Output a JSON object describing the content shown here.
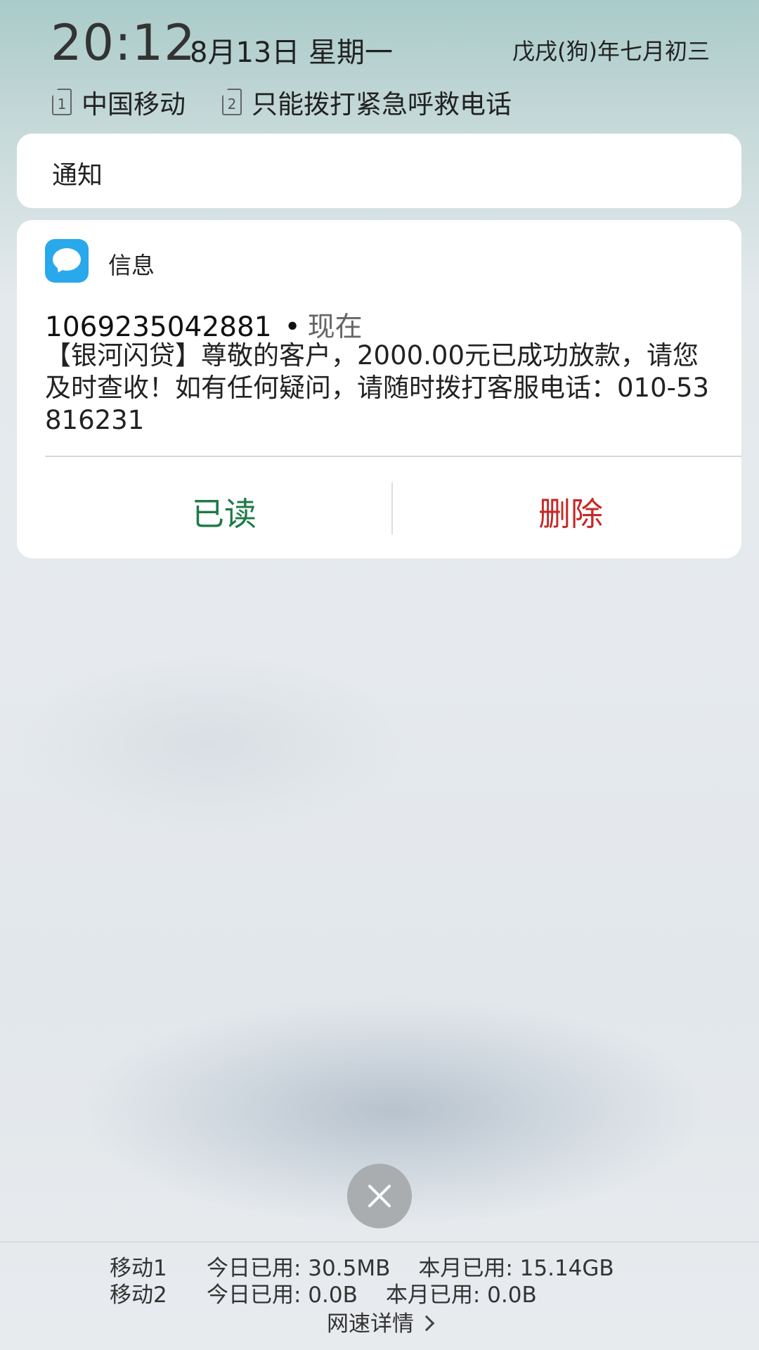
{
  "status": {
    "time": "20:12",
    "date": "8月13日 星期一",
    "lunar": "戊戌(狗)年七月初三",
    "sims": [
      {
        "slot": "1",
        "label": "中国移动"
      },
      {
        "slot": "2",
        "label": "只能拨打紧急呼救电话"
      }
    ]
  },
  "notifications": {
    "header_title": "通知",
    "message": {
      "app_icon": "message-bubble-icon",
      "app_name": "信息",
      "sender": "1069235042881",
      "separator": "•",
      "time": "现在",
      "body": "【银河闪贷】尊敬的客户，2000.00元已成功放款，请您及时查收！如有任何疑问，请随时拨打客服电话：010-53816231",
      "actions": {
        "read_label": "已读",
        "delete_label": "删除"
      }
    },
    "clear_icon": "close-icon"
  },
  "data_usage": {
    "rows": [
      {
        "label": "移动1",
        "today": "今日已用: 30.5MB",
        "month": "本月已用: 15.14GB"
      },
      {
        "label": "移动2",
        "today": "今日已用: 0.0B",
        "month": "本月已用: 0.0B"
      }
    ],
    "speed_link": "网速详情",
    "chevron_icon": "chevron-right-icon"
  },
  "colors": {
    "read_action": "#1f7a48",
    "delete_action": "#c62828",
    "app_icon": "#29a8ec"
  }
}
